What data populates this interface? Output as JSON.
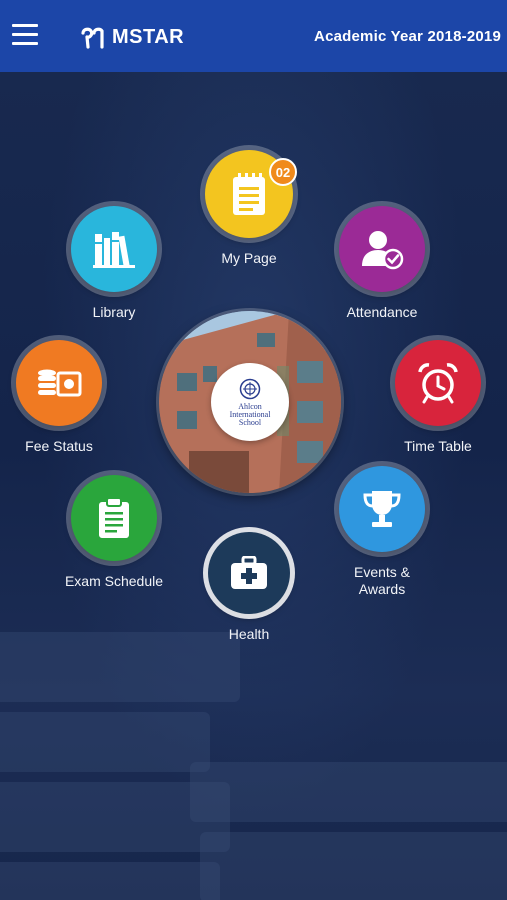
{
  "header": {
    "brand": "MSTAR",
    "academic_year": "Academic Year 2018-2019"
  },
  "center": {
    "school_name": "Ahlcon International School"
  },
  "menu": {
    "my_page": {
      "label": "My Page",
      "badge": "02",
      "color": "#f3c51f",
      "icon": "notepad-icon"
    },
    "library": {
      "label": "Library",
      "color": "#29b6dc",
      "icon": "books-icon"
    },
    "attendance": {
      "label": "Attendance",
      "color": "#9b2a96",
      "icon": "user-check-icon"
    },
    "fee_status": {
      "label": "Fee Status",
      "color": "#f07a22",
      "icon": "coins-icon"
    },
    "time_table": {
      "label": "Time Table",
      "color": "#d8243c",
      "icon": "alarm-clock-icon"
    },
    "exam_schedule": {
      "label": "Exam Schedule",
      "color": "#2aa63c",
      "icon": "clipboard-icon"
    },
    "events_awards": {
      "label": "Events &\nAwards",
      "color": "#2f97df",
      "icon": "trophy-icon"
    },
    "health": {
      "label": "Health",
      "color": "#1d3a5a",
      "icon": "first-aid-icon"
    }
  }
}
